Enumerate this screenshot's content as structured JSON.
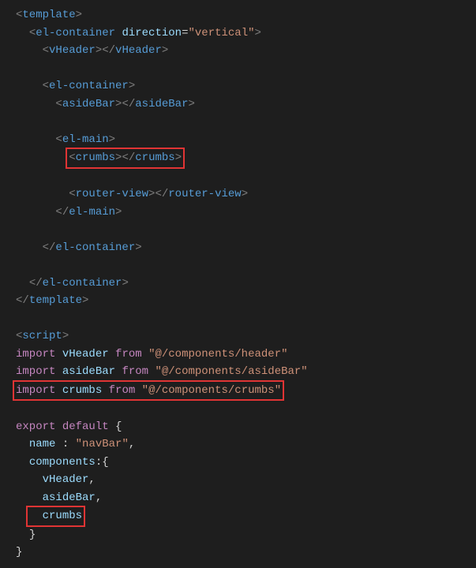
{
  "lines": {
    "l1_tag": "template",
    "l2_tag": "el-container",
    "l2_attr": "direction",
    "l2_val": "\"vertical\"",
    "l3_tag": "vHeader",
    "l5_tag": "el-container",
    "l6_tag": "asideBar",
    "l8_tag": "el-main",
    "l9_tag": "crumbs",
    "l11_tag": "router-view",
    "l12_tag": "el-main",
    "l14_tag": "el-container",
    "l16_tag": "el-container",
    "l17_tag": "template",
    "l19_tag": "script",
    "imp": "import",
    "from": "from",
    "i1_name": "vHeader",
    "i1_path": "\"@/components/header\"",
    "i2_name": "asideBar",
    "i2_path": "\"@/components/asideBar\"",
    "i3_name": "crumbs",
    "i3_path": "\"@/components/crumbs\"",
    "exp": "export",
    "def": "default",
    "name_key": "name",
    "name_val": "\"navBar\"",
    "comp_key": "components",
    "c1": "vHeader",
    "c2": "asideBar",
    "c3": "crumbs"
  }
}
